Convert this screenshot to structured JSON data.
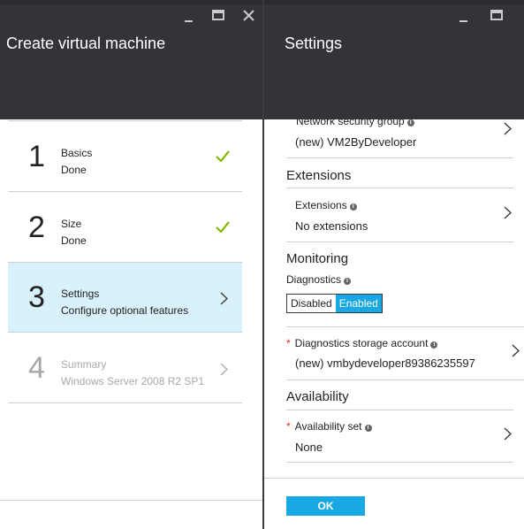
{
  "left_blade": {
    "title": "Create virtual machine",
    "steps": [
      {
        "number": "1",
        "title": "Basics",
        "subtitle": "Done",
        "state": "done"
      },
      {
        "number": "2",
        "title": "Size",
        "subtitle": "Done",
        "state": "done"
      },
      {
        "number": "3",
        "title": "Settings",
        "subtitle": "Configure optional features",
        "state": "active"
      },
      {
        "number": "4",
        "title": "Summary",
        "subtitle": "Windows Server 2008 R2 SP1",
        "state": "disabled"
      }
    ]
  },
  "right_blade": {
    "title": "Settings",
    "network_security_group": {
      "label": "Network security group",
      "value": "(new) VM2ByDeveloper"
    },
    "extensions_section": "Extensions",
    "extensions": {
      "label": "Extensions",
      "value": "No extensions"
    },
    "monitoring_section": "Monitoring",
    "diagnostics": {
      "label": "Diagnostics",
      "options": [
        "Disabled",
        "Enabled"
      ],
      "selected": "Enabled"
    },
    "diagnostics_storage": {
      "label": "Diagnostics storage account",
      "value": "(new) vmbydeveloper89386235597",
      "required": true
    },
    "availability_section": "Availability",
    "availability_set": {
      "label": "Availability set",
      "value": "None",
      "required": true
    },
    "ok_label": "OK"
  },
  "colors": {
    "header": "#32343a",
    "accent": "#19a8e3",
    "active_step": "#d8f1fb",
    "check": "#7fba00"
  }
}
